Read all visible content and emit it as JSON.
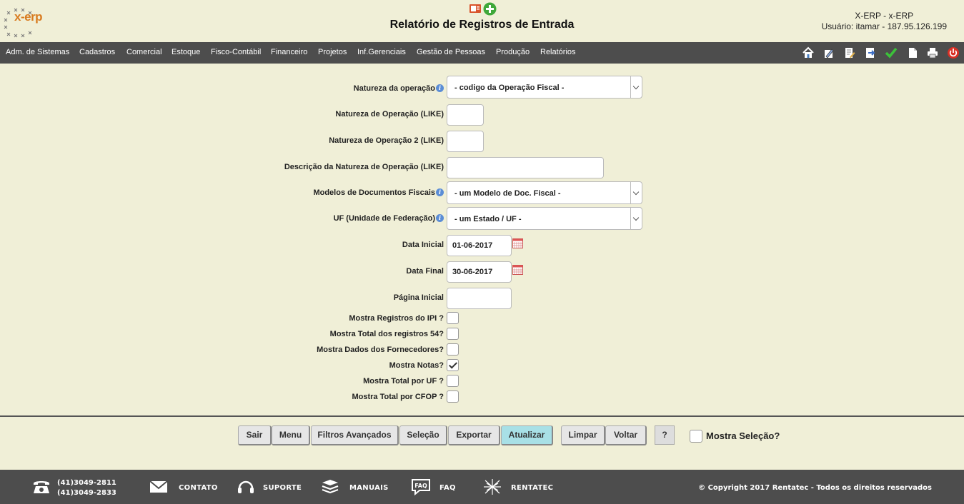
{
  "header": {
    "logo_text": "x-erp",
    "title": "Relatório de Registros de Entrada",
    "system": "X-ERP - x-ERP",
    "user": "Usuário: itamar - 187.95.126.199"
  },
  "nav": {
    "items": [
      "Adm. de Sistemas",
      "Cadastros",
      "Comercial",
      "Estoque",
      "Fisco-Contábil",
      "Financeiro",
      "Projetos",
      "Inf.Gerenciais",
      "Gestão de Pessoas",
      "Produção",
      "Relatórios"
    ],
    "icons": [
      "home-icon",
      "edit-icon",
      "document-edit-icon",
      "export-icon",
      "check-icon",
      "new-document-icon",
      "print-icon",
      "power-icon"
    ]
  },
  "form": {
    "natureza_operacao": {
      "label": "Natureza da operação",
      "value": "- codigo da Operação Fiscal -"
    },
    "natureza_like": {
      "label": "Natureza de Operação (LIKE)",
      "value": ""
    },
    "natureza2_like": {
      "label": "Natureza de Operação 2 (LIKE)",
      "value": ""
    },
    "descricao_like": {
      "label": "Descrição da Natureza de Operação (LIKE)",
      "value": ""
    },
    "modelos_docs": {
      "label": "Modelos de Documentos Fiscais",
      "value": "- um Modelo de Doc. Fiscal -"
    },
    "uf": {
      "label": "UF (Unidade de Federação)",
      "value": "- um Estado / UF -"
    },
    "data_inicial": {
      "label": "Data Inicial",
      "value": "01-06-2017"
    },
    "data_final": {
      "label": "Data Final",
      "value": "30-06-2017"
    },
    "pagina_inicial": {
      "label": "Página Inicial",
      "value": ""
    },
    "checks": [
      {
        "label": "Mostra Registros do IPI ?",
        "checked": false
      },
      {
        "label": "Mostra Total dos registros 54?",
        "checked": false
      },
      {
        "label": "Mostra Dados dos Fornecedores?",
        "checked": false
      },
      {
        "label": "Mostra Notas?",
        "checked": true
      },
      {
        "label": "Mostra Total por UF ?",
        "checked": false
      },
      {
        "label": "Mostra Total por CFOP ?",
        "checked": false
      }
    ],
    "info_glyph": "i"
  },
  "buttons": {
    "sair": "Sair",
    "menu": "Menu",
    "filtros": "Filtros Avançados",
    "selecao": "Seleção",
    "exportar": "Exportar",
    "atualizar": "Atualizar",
    "limpar": "Limpar",
    "voltar": "Voltar",
    "help": "?",
    "mostra_selecao": "Mostra Seleção?"
  },
  "footer": {
    "phone1": "(41)3049-2811",
    "phone2": "(41)3049-2833",
    "contato": "CONTATO",
    "suporte": "SUPORTE",
    "manuais": "MANUAIS",
    "faq": "FAQ",
    "faq_icon_text": "FAQ",
    "rentatec": "RENTATEC",
    "copyright": "© Copyright 2017 Rentatec - Todos os direitos reservados"
  }
}
